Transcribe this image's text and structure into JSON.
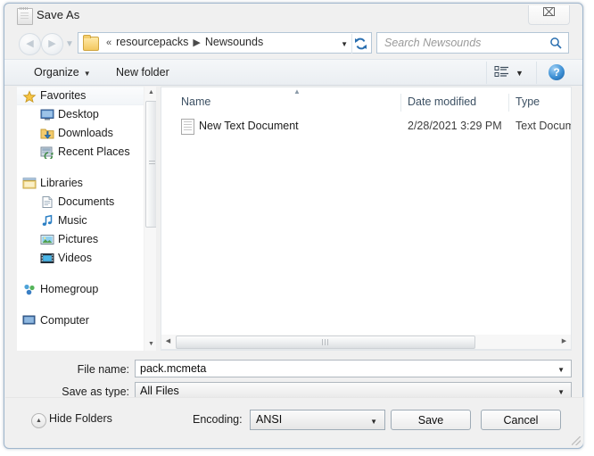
{
  "window": {
    "title": "Save As",
    "icon": "notepad-icon",
    "close_label": "⌧"
  },
  "navbar": {
    "back_arrow": "◀",
    "forward_arrow": "▶",
    "recent_arrow": "▼",
    "breadcrumb": {
      "leading_chevrons": "«",
      "items": [
        "resourcepacks",
        "Newsounds"
      ],
      "separator": "▶",
      "dropdown_caret": "▼"
    },
    "refresh_icon": "refresh-icon",
    "search": {
      "placeholder": "Search Newsounds",
      "icon": "search-icon"
    }
  },
  "toolbar": {
    "organize_label": "Organize",
    "organize_caret": "▼",
    "new_folder_label": "New folder",
    "view_mode_icon": "view-mode-icon",
    "view_mode_caret": "▼",
    "help_label": "?"
  },
  "sidebar": {
    "groups": [
      {
        "label": "Favorites",
        "icon": "star-icon",
        "highlighted": true,
        "items": [
          {
            "label": "Desktop",
            "icon": "desktop-icon"
          },
          {
            "label": "Downloads",
            "icon": "downloads-icon"
          },
          {
            "label": "Recent Places",
            "icon": "recent-places-icon"
          }
        ]
      },
      {
        "label": "Libraries",
        "icon": "libraries-icon",
        "highlighted": false,
        "items": [
          {
            "label": "Documents",
            "icon": "documents-icon"
          },
          {
            "label": "Music",
            "icon": "music-icon"
          },
          {
            "label": "Pictures",
            "icon": "pictures-icon"
          },
          {
            "label": "Videos",
            "icon": "videos-icon"
          }
        ]
      },
      {
        "label": "Homegroup",
        "icon": "homegroup-icon",
        "highlighted": false,
        "items": []
      },
      {
        "label": "Computer",
        "icon": "computer-icon",
        "highlighted": false,
        "items": []
      }
    ],
    "scrollbar": {
      "up_arrow": "▲",
      "down_arrow": "▼"
    }
  },
  "file_list": {
    "sort_indicator": "▲",
    "columns": [
      {
        "label": "Name"
      },
      {
        "label": "Date modified"
      },
      {
        "label": "Type"
      }
    ],
    "rows": [
      {
        "name": "New Text Document",
        "date_modified": "2/28/2021 3:29 PM",
        "type": "Text Docume",
        "icon": "text-document-icon"
      }
    ],
    "hscrollbar": {
      "left_arrow": "◀",
      "right_arrow": "▶"
    }
  },
  "form": {
    "file_name_label": "File name:",
    "file_name_value": "pack.mcmeta",
    "save_as_type_label": "Save as type:",
    "save_as_type_value": "All Files",
    "caret": "▼"
  },
  "footer": {
    "hide_folders_label": "Hide Folders",
    "encoding_label": "Encoding:",
    "encoding_value": "ANSI",
    "encoding_caret": "▼",
    "save_label": "Save",
    "cancel_label": "Cancel"
  },
  "colors": {
    "dialog_bg": "#f0f0f0",
    "frame_border": "#9fb6cd",
    "field_border": "#b4c6d6",
    "column_header_text": "#3c5063",
    "folder_yellow": "#f3c860",
    "help_blue": "#3c8fd4"
  }
}
